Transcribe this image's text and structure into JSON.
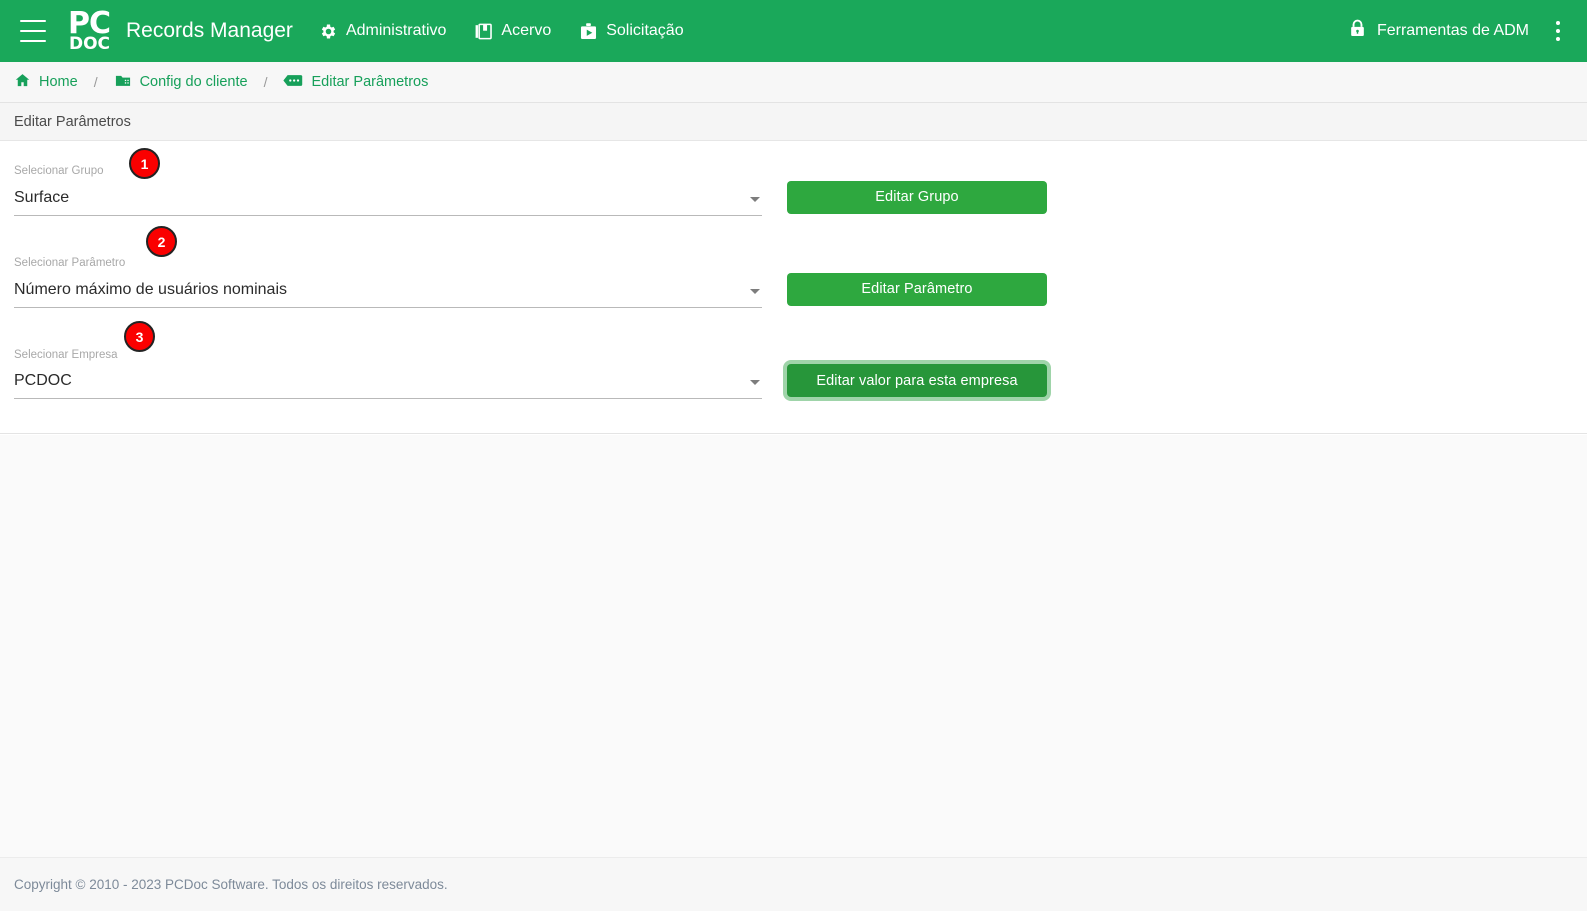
{
  "topbar": {
    "menu_icon": "hamburger-icon",
    "logo_line1": "PC",
    "logo_line2": "DOC",
    "app_title": "Records Manager",
    "nav_items": [
      {
        "label": "Administrativo",
        "icon": "gear-icon"
      },
      {
        "label": "Acervo",
        "icon": "library-books-icon"
      },
      {
        "label": "Solicitação",
        "icon": "request-play-icon"
      }
    ],
    "adm_tools": {
      "label": "Ferramentas de ADM",
      "icon": "lock-icon"
    },
    "overflow_icon": "kebab-menu-icon",
    "background_color": "#1aa85a"
  },
  "breadcrumb": {
    "separator": "/",
    "items": [
      {
        "label": "Home",
        "icon": "home-icon"
      },
      {
        "label": "Config do cliente",
        "icon": "folder-plus-icon"
      },
      {
        "label": "Editar Parâmetros",
        "icon": "ellipsis-tag-icon"
      }
    ],
    "link_color": "#17a05a"
  },
  "page_title": "Editar Parâmetros",
  "form": {
    "rows": [
      {
        "badge": "1",
        "label": "Selecionar Grupo",
        "value": "Surface",
        "dropdown_icon": "chevron-down-icon",
        "button": "Editar Grupo",
        "button_focused": false
      },
      {
        "badge": "2",
        "label": "Selecionar Parâmetro",
        "value": "Número máximo de usuários nominais",
        "dropdown_icon": "chevron-down-icon",
        "button": "Editar Parâmetro",
        "button_focused": false
      },
      {
        "badge": "3",
        "label": "Selecionar Empresa",
        "value": "PCDOC",
        "dropdown_icon": "chevron-down-icon",
        "button": "Editar valor para esta empresa",
        "button_focused": true
      }
    ],
    "button_color": "#2ea83f",
    "button_focused_color": "#27963a"
  },
  "footer": {
    "copyright": "Copyright © 2010 - 2023 PCDoc Software. Todos os direitos reservados."
  }
}
